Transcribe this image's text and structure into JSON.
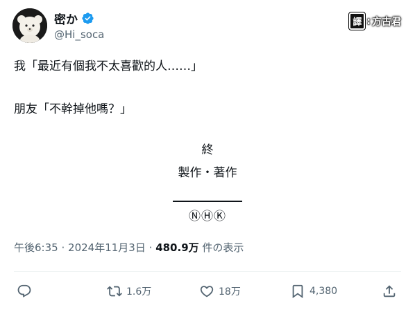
{
  "tweet": {
    "display_name": "密か",
    "handle": "@Hi_soca",
    "translator_tag": "譯",
    "translator_name": "方古君",
    "body_line1": "我「最近有個我不太喜歡的人……」",
    "body_line2": "朋友「不幹掉他嗎？」",
    "credits_end": "終",
    "credits_production": "製作・著作",
    "credits_nhk": "ⓃⒽⓀ",
    "time": "午後6:35",
    "date": "2024年11月3日",
    "views": "480.9万",
    "views_label": "件の表示",
    "sep": "·"
  },
  "actions": {
    "reply_icon": "reply-icon",
    "retweet_count": "1.6万",
    "like_count": "18万",
    "bookmark_count": "4,380",
    "share_icon": "share-icon"
  },
  "colors": {
    "text": "#0f1419",
    "secondary": "#536471",
    "verified": "#1d9bf0"
  }
}
